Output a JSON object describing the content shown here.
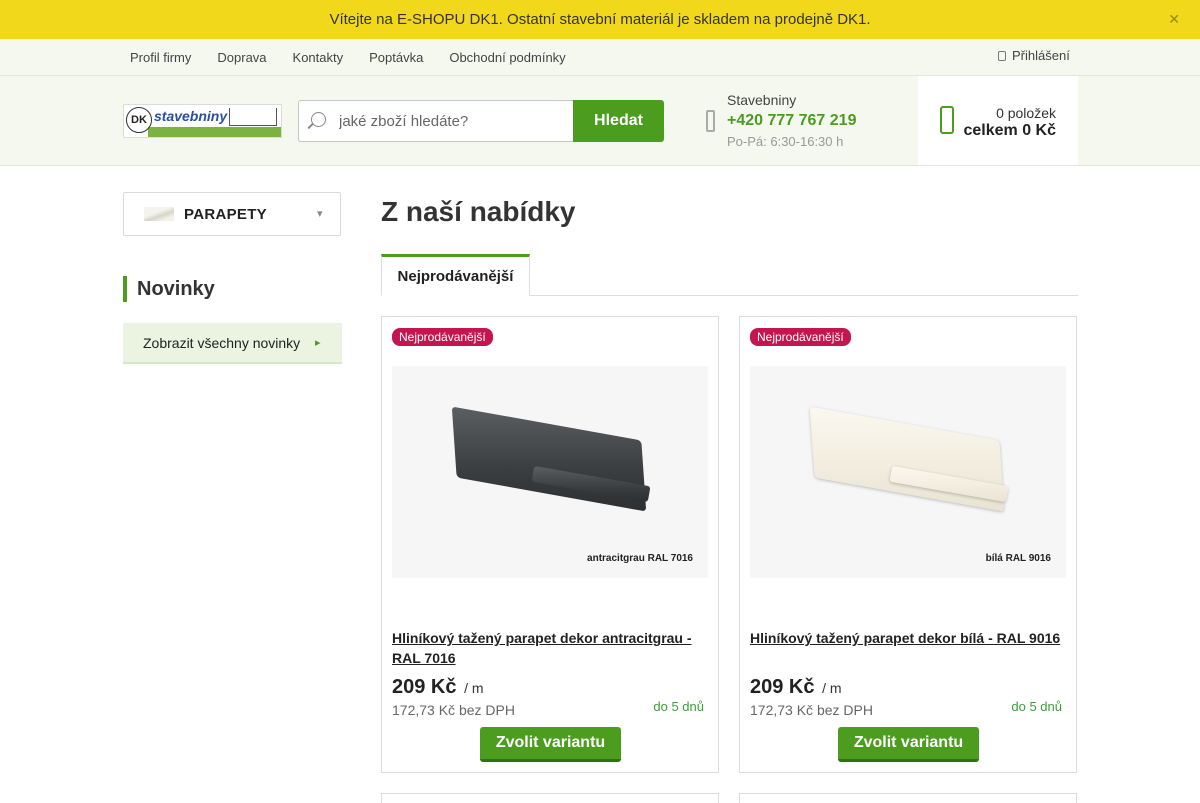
{
  "banner": {
    "text": "Vítejte na E-SHOPU DK1. Ostatní stavební materiál je skladem na prodejně DK1.",
    "close_icon": "close-icon"
  },
  "topnav": {
    "links": [
      "Profil firmy",
      "Doprava",
      "Kontakty",
      "Poptávka",
      "Obchodní podmínky"
    ],
    "login_label": "Přihlášení"
  },
  "header": {
    "logo": {
      "mark": "DK",
      "text": "stavebniny"
    },
    "search": {
      "placeholder": "jaké zboží hledáte?",
      "button_label": "Hledat"
    },
    "contact": {
      "label": "Stavebniny",
      "phone": "+420 777 767 219",
      "hours": "Po-Pá: 6:30-16:30 h"
    },
    "cart": {
      "count": "0 položek",
      "total": "celkem 0 Kč"
    }
  },
  "sidebar": {
    "category": {
      "label": "PARAPETY",
      "icon": "chevron-down-icon"
    },
    "news": {
      "heading": "Novinky",
      "button_label": "Zobrazit všechny novinky"
    }
  },
  "main": {
    "title": "Z naší nabídky",
    "tabs": [
      {
        "label": "Nejprodávanější",
        "active": true
      }
    ],
    "products": [
      {
        "badge": "Nejprodávanější",
        "image_caption": "antracitgrau RAL 7016",
        "title": "Hliníkový tažený parapet dekor antracitgrau - RAL 7016",
        "price": "209 Kč",
        "unit": "/ m",
        "price_vat": "172,73 Kč bez DPH",
        "stock": "do 5 dnů",
        "button_label": "Zvolit variantu"
      },
      {
        "badge": "Nejprodávanější",
        "image_caption": "bílá RAL 9016",
        "title": "Hliníkový tažený parapet dekor bílá - RAL 9016",
        "price": "209 Kč",
        "unit": "/ m",
        "price_vat": "172,73 Kč bez DPH",
        "stock": "do 5 dnů",
        "button_label": "Zvolit variantu"
      }
    ]
  },
  "colors": {
    "banner": "#f2d81a",
    "accent_green": "#4c9d1e",
    "badge": "#c4154f",
    "header_bg": "#f4f8ef"
  }
}
